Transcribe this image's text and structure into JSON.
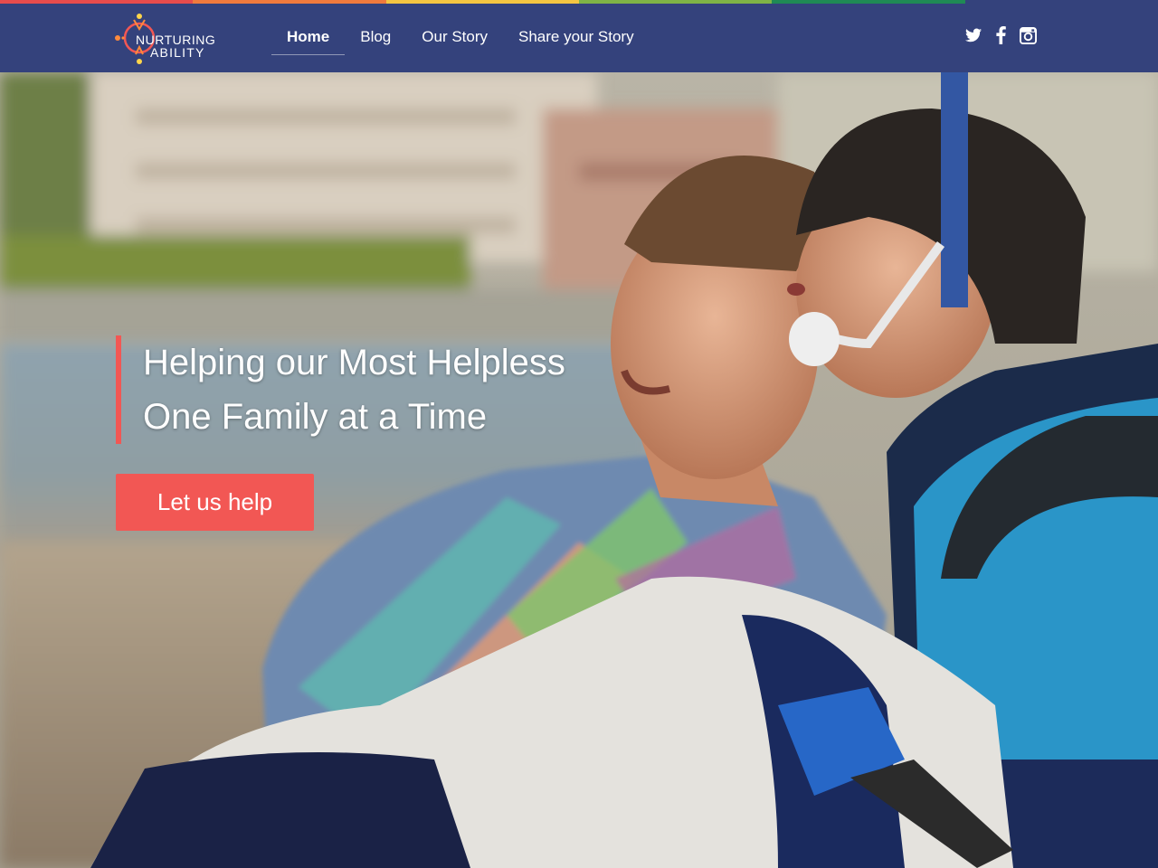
{
  "brand": {
    "line1": "NURTURING",
    "line2": "ABILITY",
    "logo_colors": [
      "#f25754",
      "#ff8a3c",
      "#ffd54a"
    ]
  },
  "top_strip_colors": [
    "#e74c4c",
    "#f07a3d",
    "#f4c542",
    "#7fb446",
    "#1f8a55",
    "#34427c"
  ],
  "nav": {
    "items": [
      {
        "label": "Home",
        "active": true
      },
      {
        "label": "Blog",
        "active": false
      },
      {
        "label": "Our Story",
        "active": false
      },
      {
        "label": "Share your Story",
        "active": false
      }
    ]
  },
  "socials": [
    {
      "icon": "twitter-icon"
    },
    {
      "icon": "facebook-icon"
    },
    {
      "icon": "instagram-icon"
    }
  ],
  "hero": {
    "headline_line1": "Helping our Most Helpless",
    "headline_line2": "One Family at a Time",
    "cta_label": "Let us help",
    "accent_color": "#f25754"
  },
  "colors": {
    "navbar": "#34427c",
    "accent": "#f25754"
  }
}
